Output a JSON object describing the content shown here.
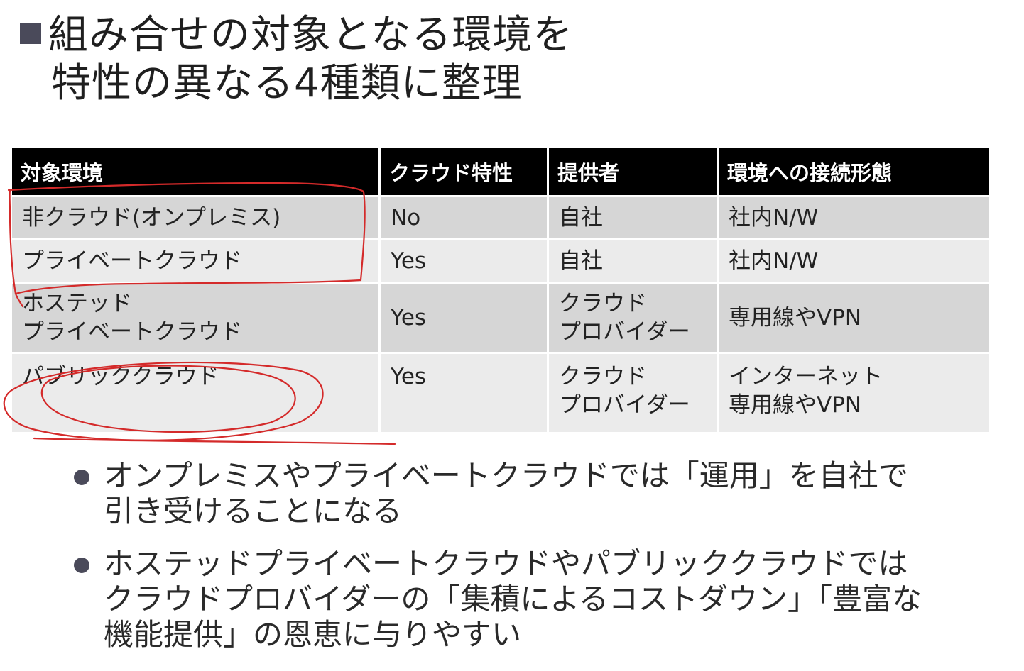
{
  "title": {
    "line1": "組み合せの対象となる環境を",
    "line2": "特性の異なる4種類に整理"
  },
  "table": {
    "headers": [
      "対象環境",
      "クラウド特性",
      "提供者",
      "環境への接続形態"
    ],
    "rows": [
      {
        "environment": [
          "非クラウド(オンプレミス)"
        ],
        "cloud": "No",
        "provider": [
          "自社"
        ],
        "connection": [
          "社内N/W"
        ]
      },
      {
        "environment": [
          "プライベートクラウド"
        ],
        "cloud": "Yes",
        "provider": [
          "自社"
        ],
        "connection": [
          "社内N/W"
        ]
      },
      {
        "environment": [
          "ホステッド",
          "プライベートクラウド"
        ],
        "cloud": "Yes",
        "provider": [
          "クラウド",
          "プロバイダー"
        ],
        "connection": [
          "専用線やVPN"
        ]
      },
      {
        "environment": [
          "パブリッククラウド"
        ],
        "cloud": "Yes",
        "provider": [
          "クラウド",
          "プロバイダー"
        ],
        "connection": [
          "インターネット",
          "専用線やVPN"
        ]
      }
    ]
  },
  "bullets": [
    {
      "lines": [
        "オンプレミスやプライベートクラウドでは「運用」を自社で",
        "引き受けることになる"
      ]
    },
    {
      "lines": [
        "ホステッドプライベートクラウドやパブリッククラウドでは",
        "クラウドプロバイダーの「集積によるコストダウン」「豊富な",
        "機能提供」の恩恵に与りやすい"
      ]
    }
  ],
  "colors": {
    "header_bg": "#000000",
    "row_dark": "#d6d6d6",
    "row_light": "#ebebeb",
    "marker": "#4a4a5a",
    "annotation_ink": "#d42a2a"
  },
  "icons": {
    "title_marker": "square-bullet",
    "bullet": "circle-bullet"
  }
}
